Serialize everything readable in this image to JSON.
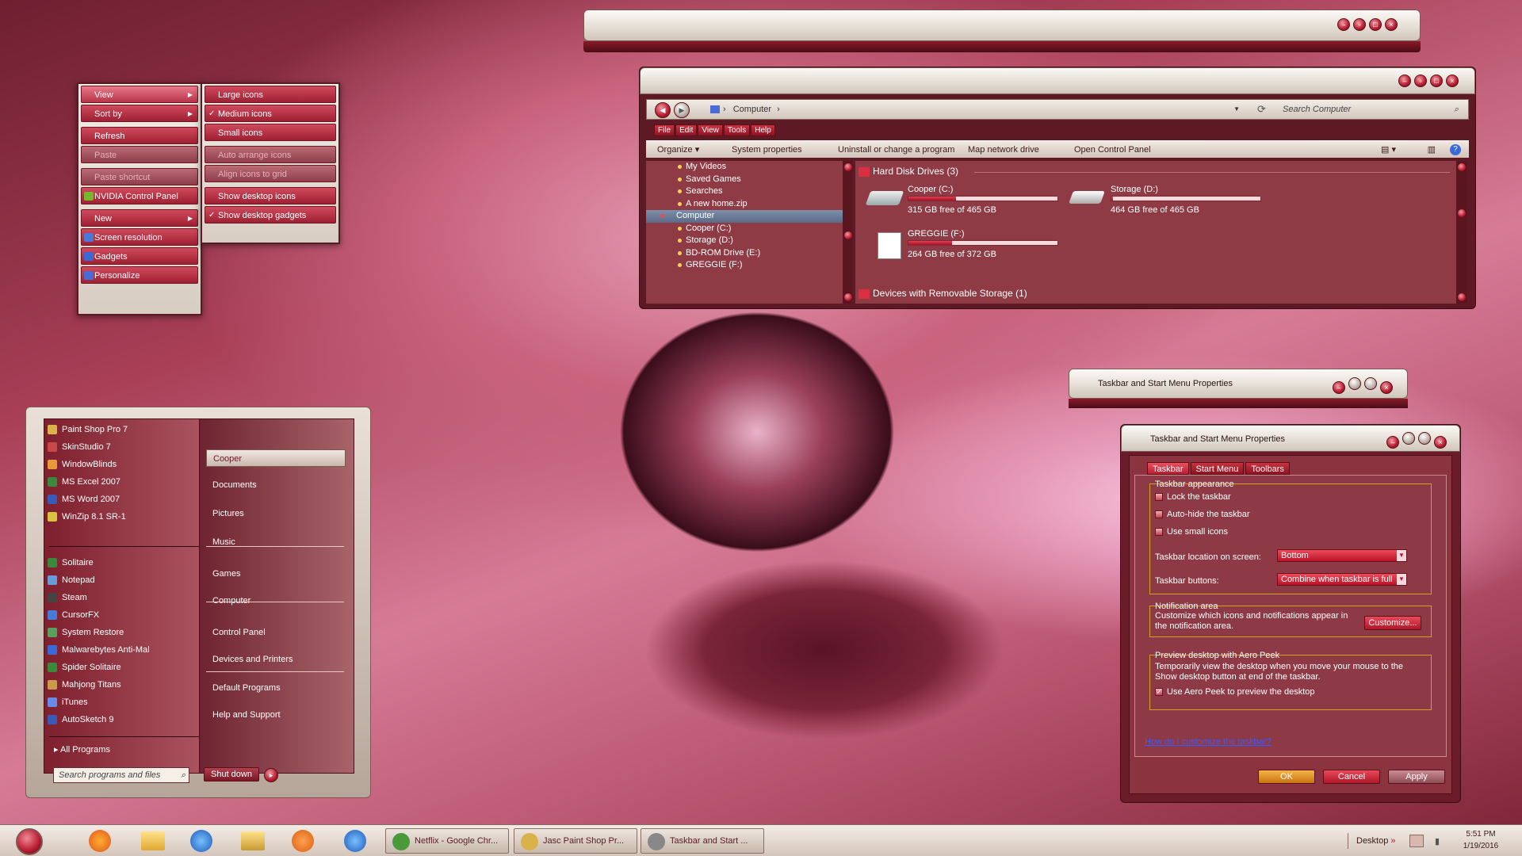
{
  "context_menu": {
    "items": [
      {
        "label": "View",
        "arrow": true
      },
      {
        "label": "Sort by",
        "arrow": true
      },
      {
        "label": "Refresh"
      },
      {
        "label": "Paste",
        "disabled": true
      },
      {
        "label": "Paste shortcut",
        "disabled": true
      },
      {
        "label": "NVIDIA Control Panel",
        "icon": "nvidia-icon"
      },
      {
        "label": "New",
        "arrow": true
      },
      {
        "label": "Screen resolution",
        "icon": "display-icon"
      },
      {
        "label": "Gadgets",
        "icon": "gadgets-icon"
      },
      {
        "label": "Personalize",
        "icon": "personalize-icon"
      }
    ],
    "submenu": [
      {
        "label": "Large icons"
      },
      {
        "label": "Medium icons",
        "checked": true
      },
      {
        "label": "Small icons"
      },
      {
        "label": "Auto arrange icons",
        "disabled": true
      },
      {
        "label": "Align icons to grid",
        "disabled": true
      },
      {
        "label": "Show desktop icons"
      },
      {
        "label": "Show desktop gadgets",
        "checked": true
      }
    ]
  },
  "explorer": {
    "address": "Computer",
    "search_placeholder": "Search Computer",
    "menubar": [
      "File",
      "Edit",
      "View",
      "Tools",
      "Help"
    ],
    "toolbar": [
      "Organize",
      "System properties",
      "Uninstall or change a program",
      "Map network drive",
      "Open Control Panel"
    ],
    "tree": [
      {
        "label": "My Videos"
      },
      {
        "label": "Saved Games"
      },
      {
        "label": "Searches"
      },
      {
        "label": "A new home.zip"
      },
      {
        "label": "Computer",
        "selected": true
      },
      {
        "label": "Cooper (C:)"
      },
      {
        "label": "Storage (D:)"
      },
      {
        "label": "BD-ROM Drive (E:)"
      },
      {
        "label": "GREGGIE (F:)"
      }
    ],
    "group_hdd": "Hard Disk Drives (3)",
    "group_removable": "Devices with Removable Storage (1)",
    "drives": [
      {
        "name": "Cooper (C:)",
        "free": "315 GB free of 465 GB",
        "used_fraction": 0.32
      },
      {
        "name": "Storage (D:)",
        "free": "464 GB free of 465 GB",
        "used_fraction": 0.01
      },
      {
        "name": "GREGGIE (F:)",
        "free": "264 GB free of 372 GB",
        "used_fraction": 0.29
      }
    ]
  },
  "taskbar_props_small": {
    "title": "Taskbar and Start Menu Properties"
  },
  "taskbar_props": {
    "title": "Taskbar and Start Menu Properties",
    "tabs": [
      "Taskbar",
      "Start Menu",
      "Toolbars"
    ],
    "appearance_title": "Taskbar appearance",
    "lock": "Lock the taskbar",
    "autohide": "Auto-hide the taskbar",
    "small_icons": "Use small icons",
    "location_label": "Taskbar location on screen:",
    "location_value": "Bottom",
    "buttons_label": "Taskbar buttons:",
    "buttons_value": "Combine when taskbar is full",
    "notif_title": "Notification area",
    "notif_text": "Customize which icons and notifications appear in the notification area.",
    "customize": "Customize...",
    "peek_title": "Preview desktop with Aero Peek",
    "peek_text": "Temporarily view the desktop when you move your mouse to the Show desktop button at end of the taskbar.",
    "peek_check": "Use Aero Peek to preview the desktop",
    "link": "How do I customize the taskbar?",
    "ok": "OK",
    "cancel": "Cancel",
    "apply": "Apply"
  },
  "start_menu": {
    "programs": [
      {
        "label": "Paint Shop Pro 7",
        "arrow": true,
        "color": "#d9b34a"
      },
      {
        "label": "SkinStudio 7",
        "color": "#c84848"
      },
      {
        "label": "WindowBlinds",
        "color": "#e89a3a"
      },
      {
        "label": "MS Excel 2007",
        "arrow": true,
        "color": "#3a8a3a"
      },
      {
        "label": "MS Word 2007",
        "arrow": true,
        "color": "#3a5ab8"
      },
      {
        "label": "WinZip 8.1 SR-1",
        "arrow": true,
        "color": "#d8c040"
      }
    ],
    "recent": [
      {
        "label": "Solitaire",
        "color": "#3a8a3a"
      },
      {
        "label": "Notepad",
        "arrow": true,
        "color": "#6a9ad8"
      },
      {
        "label": "Steam",
        "arrow": true,
        "color": "#444"
      },
      {
        "label": "CursorFX",
        "color": "#4a7ad8"
      },
      {
        "label": "System Restore",
        "color": "#5aa05a"
      },
      {
        "label": "Malwarebytes Anti-Mal",
        "color": "#3a6ad8"
      },
      {
        "label": "Spider Solitaire",
        "color": "#3a8a3a"
      },
      {
        "label": "Mahjong Titans",
        "color": "#c89a4a"
      },
      {
        "label": "iTunes",
        "color": "#6a8ae8"
      },
      {
        "label": "AutoSketch 9",
        "color": "#3a5ab8"
      }
    ],
    "all_programs": "All Programs",
    "search_placeholder": "Search programs and files",
    "shutdown": "Shut down",
    "right": [
      "Cooper",
      "Documents",
      "Pictures",
      "Music",
      "Games",
      "Computer",
      "Control Panel",
      "Devices and Printers",
      "Default Programs",
      "Help and Support"
    ]
  },
  "taskbar": {
    "items": [
      {
        "label": "Netflix - Google Chr...",
        "color": "#4a9a3a"
      },
      {
        "label": "Jasc Paint Shop Pr...",
        "color": "#d9b34a"
      },
      {
        "label": "Taskbar and Start ...",
        "color": "#888"
      }
    ],
    "desktop": "Desktop",
    "time": "5:51 PM",
    "date": "1/19/2016"
  }
}
